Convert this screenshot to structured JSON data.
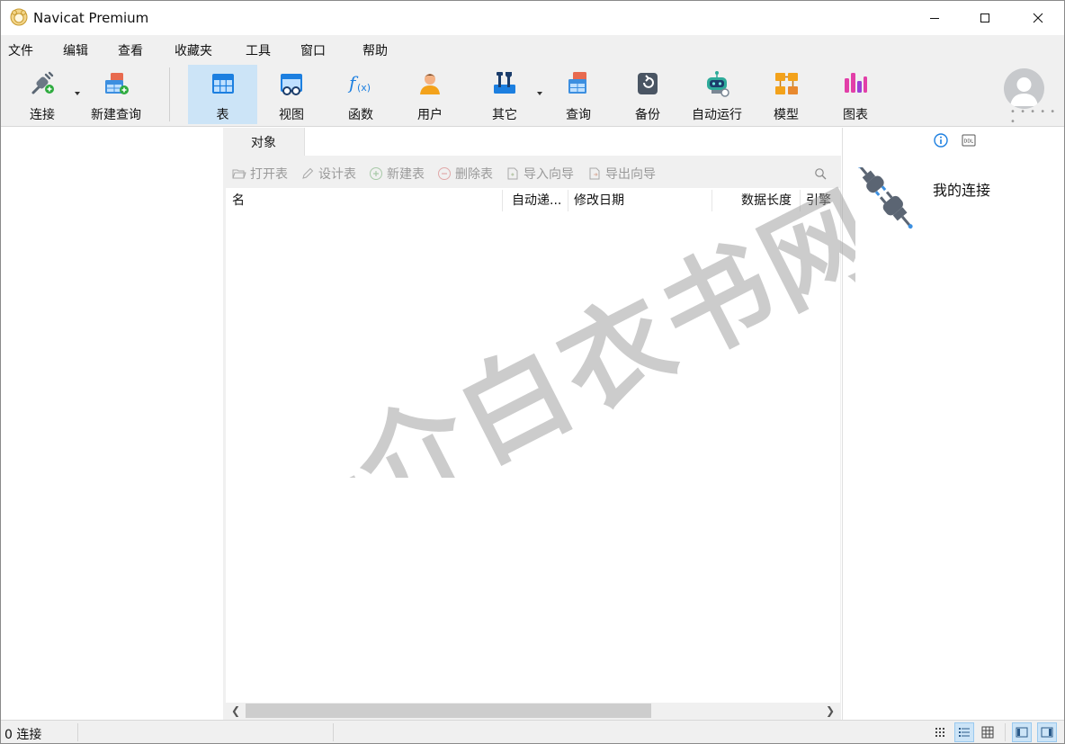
{
  "window": {
    "title": "Navicat Premium",
    "controls": {
      "minimize": "minimize-icon",
      "maximize": "maximize-icon",
      "close": "close-icon"
    }
  },
  "menu": [
    "文件",
    "编辑",
    "查看",
    "收藏夹",
    "工具",
    "窗口",
    "帮助"
  ],
  "toolbar": {
    "connect": "连接",
    "new_query": "新建查询",
    "table": "表",
    "view": "视图",
    "function": "函数",
    "user": "用户",
    "other": "其它",
    "query": "查询",
    "backup": "备份",
    "automation": "自动运行",
    "model": "模型",
    "chart": "图表",
    "active": "表"
  },
  "object_tab": {
    "label": "对象"
  },
  "object_toolbar": {
    "open_table": "打开表",
    "design_table": "设计表",
    "new_table": "新建表",
    "delete_table": "删除表",
    "import_wizard": "导入向导",
    "export_wizard": "导出向导"
  },
  "columns": {
    "name": "名",
    "auto_increment": "自动递...",
    "modified_date": "修改日期",
    "data_length": "数据长度",
    "engine": "引擎"
  },
  "info_pane": {
    "title": "我的连接"
  },
  "status": {
    "connections": "0 连接"
  },
  "watermark_text": "一介白衣书网",
  "colors": {
    "accent": "#0078d4",
    "active_bg": "#cce4f7",
    "chrome": "#f0f0f0"
  }
}
